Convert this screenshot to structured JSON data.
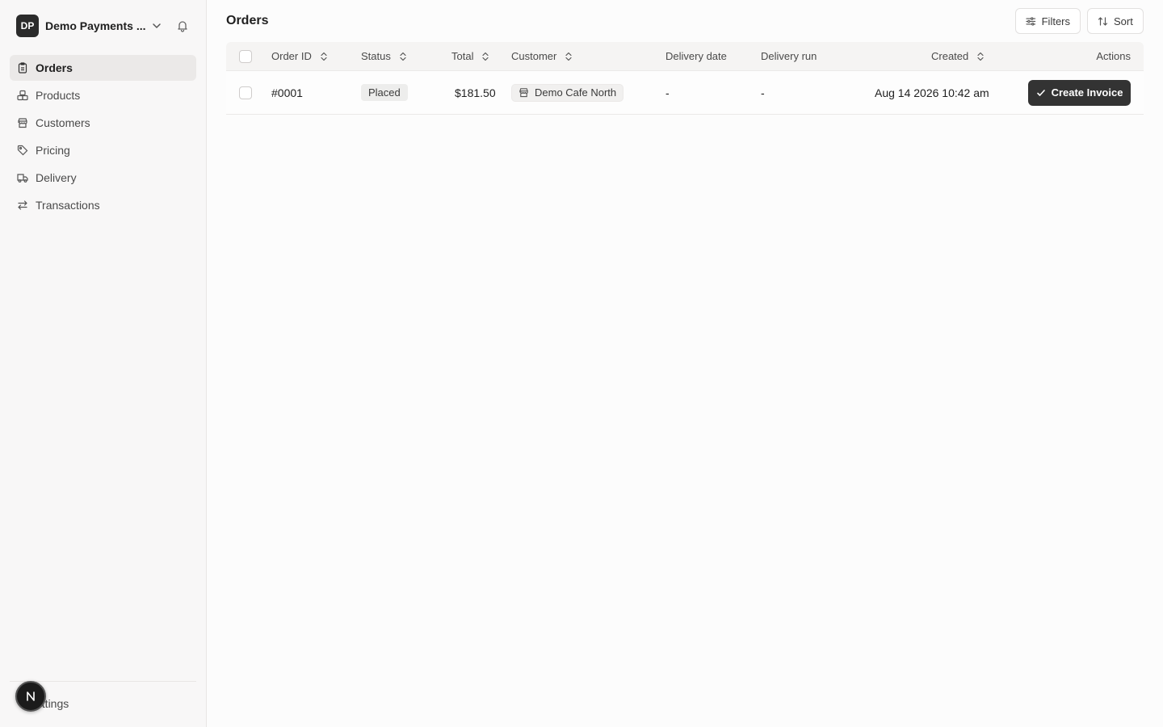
{
  "org": {
    "initials": "DP",
    "name": "Demo Payments ...",
    "chevron_icon": "chevron-down-icon",
    "bell_icon": "bell-icon"
  },
  "nav": {
    "items": [
      {
        "label": "Orders",
        "icon": "clipboard-icon",
        "active": true
      },
      {
        "label": "Products",
        "icon": "boxes-icon",
        "active": false
      },
      {
        "label": "Customers",
        "icon": "store-icon",
        "active": false
      },
      {
        "label": "Pricing",
        "icon": "tag-icon",
        "active": false
      },
      {
        "label": "Delivery",
        "icon": "truck-icon",
        "active": false
      },
      {
        "label": "Transactions",
        "icon": "arrows-swap-icon",
        "active": false
      }
    ],
    "settings_label": "ettings"
  },
  "fab": {
    "letter": "N"
  },
  "page": {
    "title": "Orders"
  },
  "toolbar": {
    "filters_label": "Filters",
    "sort_label": "Sort"
  },
  "table": {
    "headers": {
      "order_id": "Order ID",
      "status": "Status",
      "total": "Total",
      "customer": "Customer",
      "delivery_date": "Delivery date",
      "delivery_run": "Delivery run",
      "created": "Created",
      "actions": "Actions"
    },
    "rows": [
      {
        "order_id": "#0001",
        "status": "Placed",
        "total": "$181.50",
        "customer": "Demo Cafe North",
        "delivery_date": "-",
        "delivery_run": "-",
        "created": "Aug 14 2026 10:42 am",
        "action_label": "Create Invoice"
      }
    ]
  }
}
